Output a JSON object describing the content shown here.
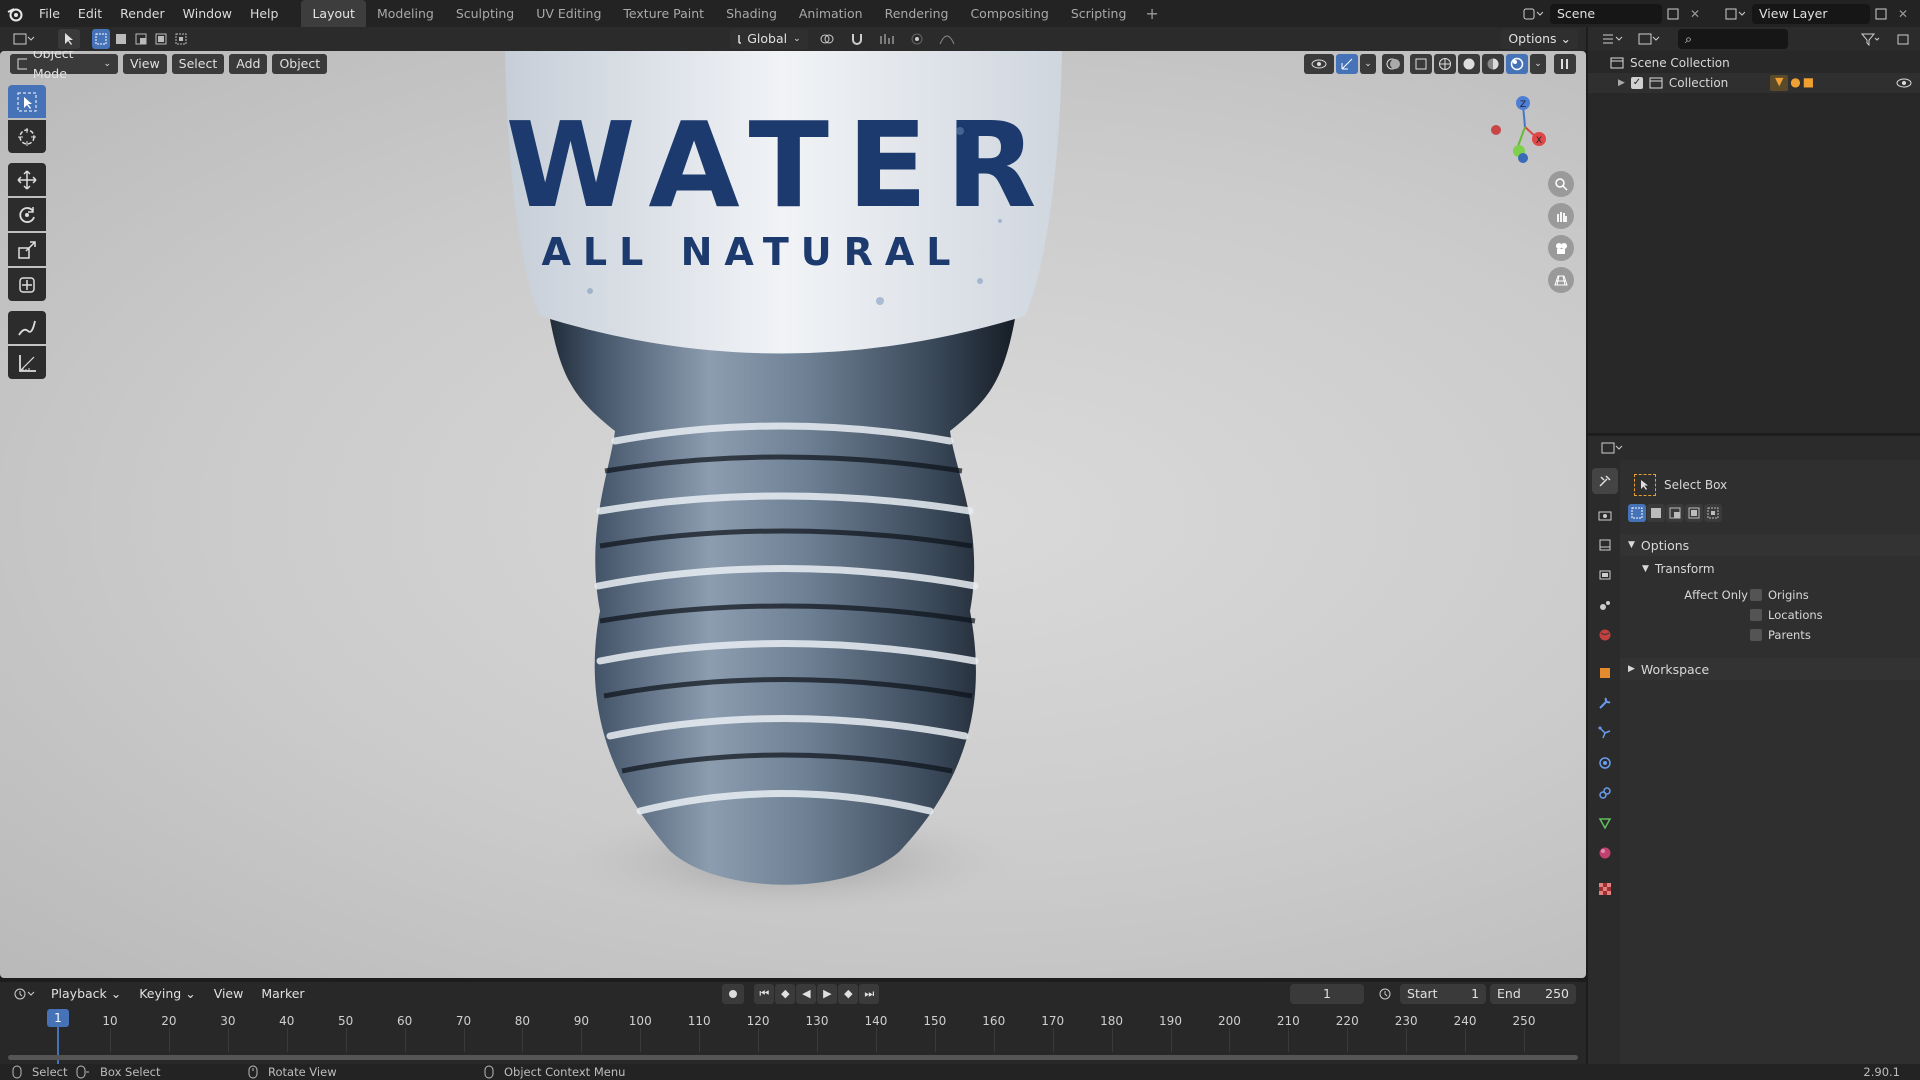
{
  "app": {
    "version": "2.90.1"
  },
  "top_menu": [
    "File",
    "Edit",
    "Render",
    "Window",
    "Help"
  ],
  "workspace_tabs": [
    {
      "label": "Layout",
      "active": true
    },
    {
      "label": "Modeling"
    },
    {
      "label": "Sculpting"
    },
    {
      "label": "UV Editing"
    },
    {
      "label": "Texture Paint"
    },
    {
      "label": "Shading"
    },
    {
      "label": "Animation"
    },
    {
      "label": "Rendering"
    },
    {
      "label": "Compositing"
    },
    {
      "label": "Scripting"
    }
  ],
  "scene": {
    "name": "Scene"
  },
  "view_layer": {
    "name": "View Layer"
  },
  "tool_header": {
    "transform_orientation": "Global",
    "options_label": "Options"
  },
  "viewport_header": {
    "mode": "Object Mode",
    "menus": [
      "View",
      "Select",
      "Add",
      "Object"
    ]
  },
  "viewport_render": {
    "label_main": "WATER",
    "label_sub": "ALL NATURAL",
    "label_color": "#1c3a6e"
  },
  "outliner": {
    "root": "Scene Collection",
    "collection": "Collection"
  },
  "properties": {
    "tool_name": "Select Box",
    "options_label": "Options",
    "transform_label": "Transform",
    "affect_only_label": "Affect Only",
    "affect_options": [
      "Origins",
      "Locations",
      "Parents"
    ],
    "workspace_label": "Workspace"
  },
  "timeline": {
    "menus": [
      "Playback",
      "Keying",
      "View",
      "Marker"
    ],
    "current_frame": "1",
    "start_label": "Start",
    "start": "1",
    "end_label": "End",
    "end": "250",
    "ticks": [
      "1",
      "10",
      "20",
      "30",
      "40",
      "50",
      "60",
      "70",
      "80",
      "90",
      "100",
      "110",
      "120",
      "130",
      "140",
      "150",
      "160",
      "170",
      "180",
      "190",
      "200",
      "210",
      "220",
      "230",
      "240",
      "250"
    ]
  },
  "statusbar": {
    "select": "Select",
    "box_select": "Box Select",
    "rotate_view": "Rotate View",
    "context_menu": "Object Context Menu"
  },
  "colors": {
    "accent": "#4672b8",
    "header": "#2b2b2b",
    "panel": "#282828",
    "topbar": "#232323"
  }
}
